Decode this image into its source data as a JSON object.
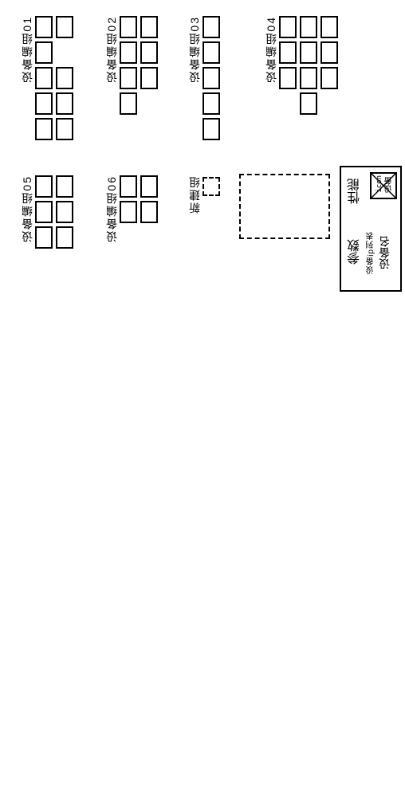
{
  "groups": {
    "g01": "设备编组01",
    "g02": "设备编组02",
    "g03": "设备编组03",
    "g04": "设备编组04",
    "g05": "设备编组05",
    "g06": "设备编组06",
    "new": "新建组"
  },
  "legend": {
    "icon_line1": "设备",
    "icon_line2": "icon",
    "device_name": "设备名",
    "device_ip": "设备ip列表",
    "perf": "性能",
    "params": "参数"
  }
}
